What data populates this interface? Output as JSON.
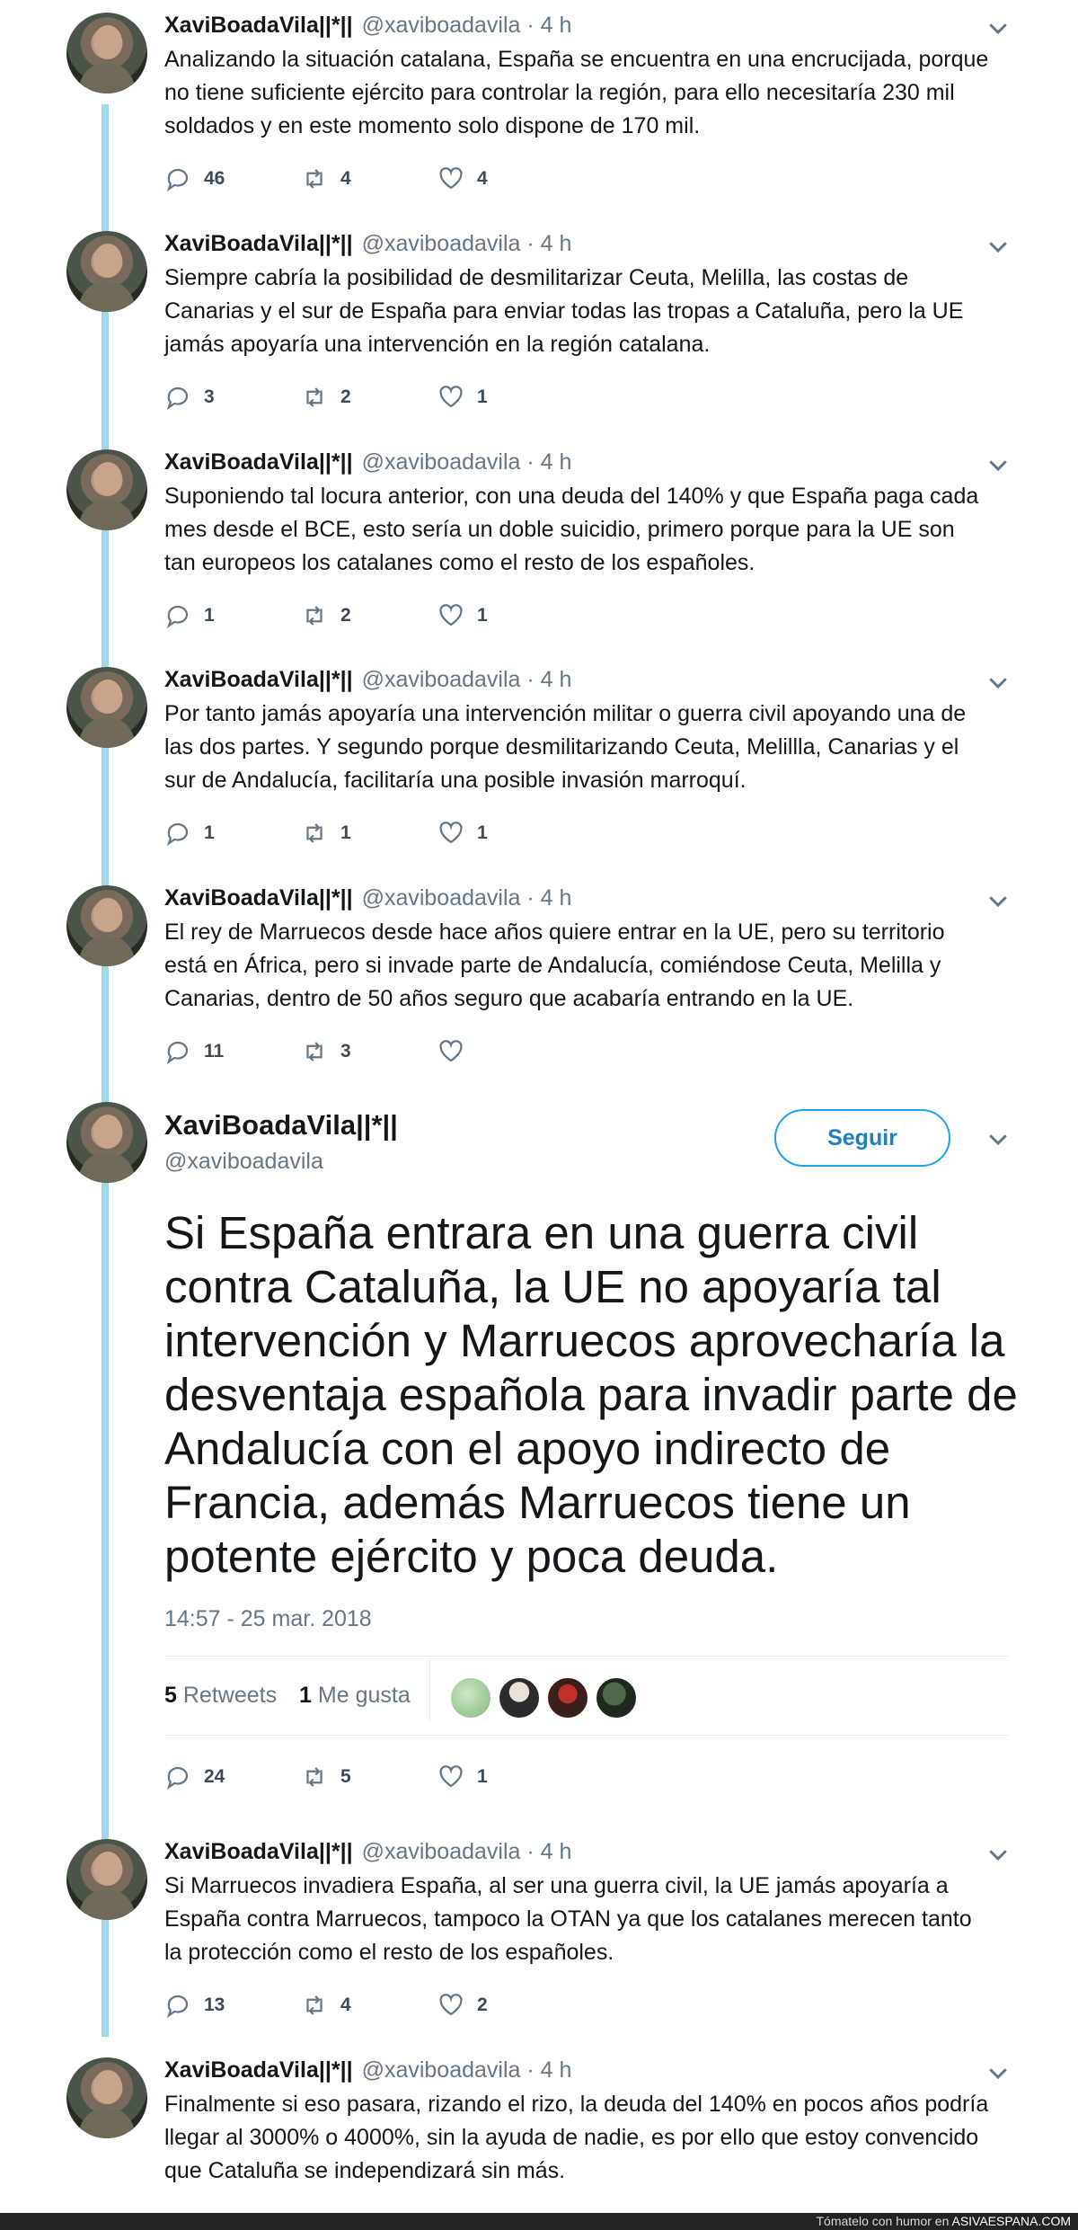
{
  "tweets": [
    {
      "name": "XaviBoadaVila||*||",
      "handle": "@xaviboadavila · 4 h",
      "text": "Analizando la situación catalana, España se encuentra en una encrucijada, porque no tiene suficiente ejército para controlar la región, para ello necesitaría 230 mil soldados y en este momento solo dispone de 170 mil.",
      "replies": "46",
      "retweets": "4",
      "likes": "4"
    },
    {
      "name": "XaviBoadaVila||*||",
      "handle": "@xaviboadavila · 4 h",
      "text": "Siempre cabría la posibilidad de desmilitarizar Ceuta, Melilla, las costas de Canarias y el sur de España para enviar todas las tropas a Cataluña, pero la UE jamás apoyaría una intervención en la región catalana.",
      "replies": "3",
      "retweets": "2",
      "likes": "1"
    },
    {
      "name": "XaviBoadaVila||*||",
      "handle": "@xaviboadavila · 4 h",
      "text": "Suponiendo tal locura anterior, con una deuda del 140% y que España paga cada mes desde el BCE, esto sería un doble suicidio, primero porque para la UE son tan europeos los catalanes como el resto de los españoles.",
      "replies": "1",
      "retweets": "2",
      "likes": "1"
    },
    {
      "name": "XaviBoadaVila||*||",
      "handle": "@xaviboadavila · 4 h",
      "text": "Por tanto jamás apoyaría una intervención militar o guerra civil apoyando una de las dos partes. Y segundo porque desmilitarizando Ceuta, Melillla, Canarias y el sur de Andalucía, facilitaría una posible invasión marroquí.",
      "replies": "1",
      "retweets": "1",
      "likes": "1"
    },
    {
      "name": "XaviBoadaVila||*||",
      "handle": "@xaviboadavila · 4 h",
      "text": "El rey de Marruecos desde hace años quiere entrar en la UE, pero su territorio está en África, pero si invade parte de Andalucía, comiéndose Ceuta, Melilla y Canarias, dentro de 50 años seguro que acabaría entrando en la UE.",
      "replies": "11",
      "retweets": "3",
      "likes": ""
    }
  ],
  "main_tweet": {
    "name": "XaviBoadaVila||*||",
    "handle": "@xaviboadavila",
    "follow_label": "Seguir",
    "text": "Si España entrara en una guerra civil contra Cataluña, la UE no apoyaría tal intervención y Marruecos aprovecharía la desventaja española para invadir parte de Andalucía con el apoyo indirecto de Francia, además Marruecos tiene un potente ejército y poca deuda.",
    "timestamp": "14:57 - 25 mar. 2018",
    "retweets_count": "5",
    "retweets_label": "Retweets",
    "likes_count": "1",
    "likes_label": "Me gusta",
    "replies": "24",
    "retweets": "5",
    "likes": "1"
  },
  "after_tweets": [
    {
      "name": "XaviBoadaVila||*||",
      "handle": "@xaviboadavila · 4 h",
      "text": "Si Marruecos invadiera España, al ser una guerra civil, la UE jamás apoyaría a España contra Marruecos, tampoco la OTAN ya que los catalanes merecen tanto la protección como el resto de los españoles.",
      "replies": "13",
      "retweets": "4",
      "likes": "2"
    },
    {
      "name": "XaviBoadaVila||*||",
      "handle": "@xaviboadavila · 4 h",
      "text": "Finalmente si eso pasara, rizando el rizo, la deuda del 140% en pocos años podría llegar al 3000% o 4000%, sin la ayuda de nadie, es por ello que estoy convencido que Cataluña se independizará sin más."
    }
  ],
  "footer": {
    "prefix": "Tómatelo con humor en ",
    "site": "ASIVAESPANA.COM"
  },
  "colors": {
    "accent": "#1da1f2",
    "thread": "#9fd9e9",
    "muted": "#657786"
  }
}
